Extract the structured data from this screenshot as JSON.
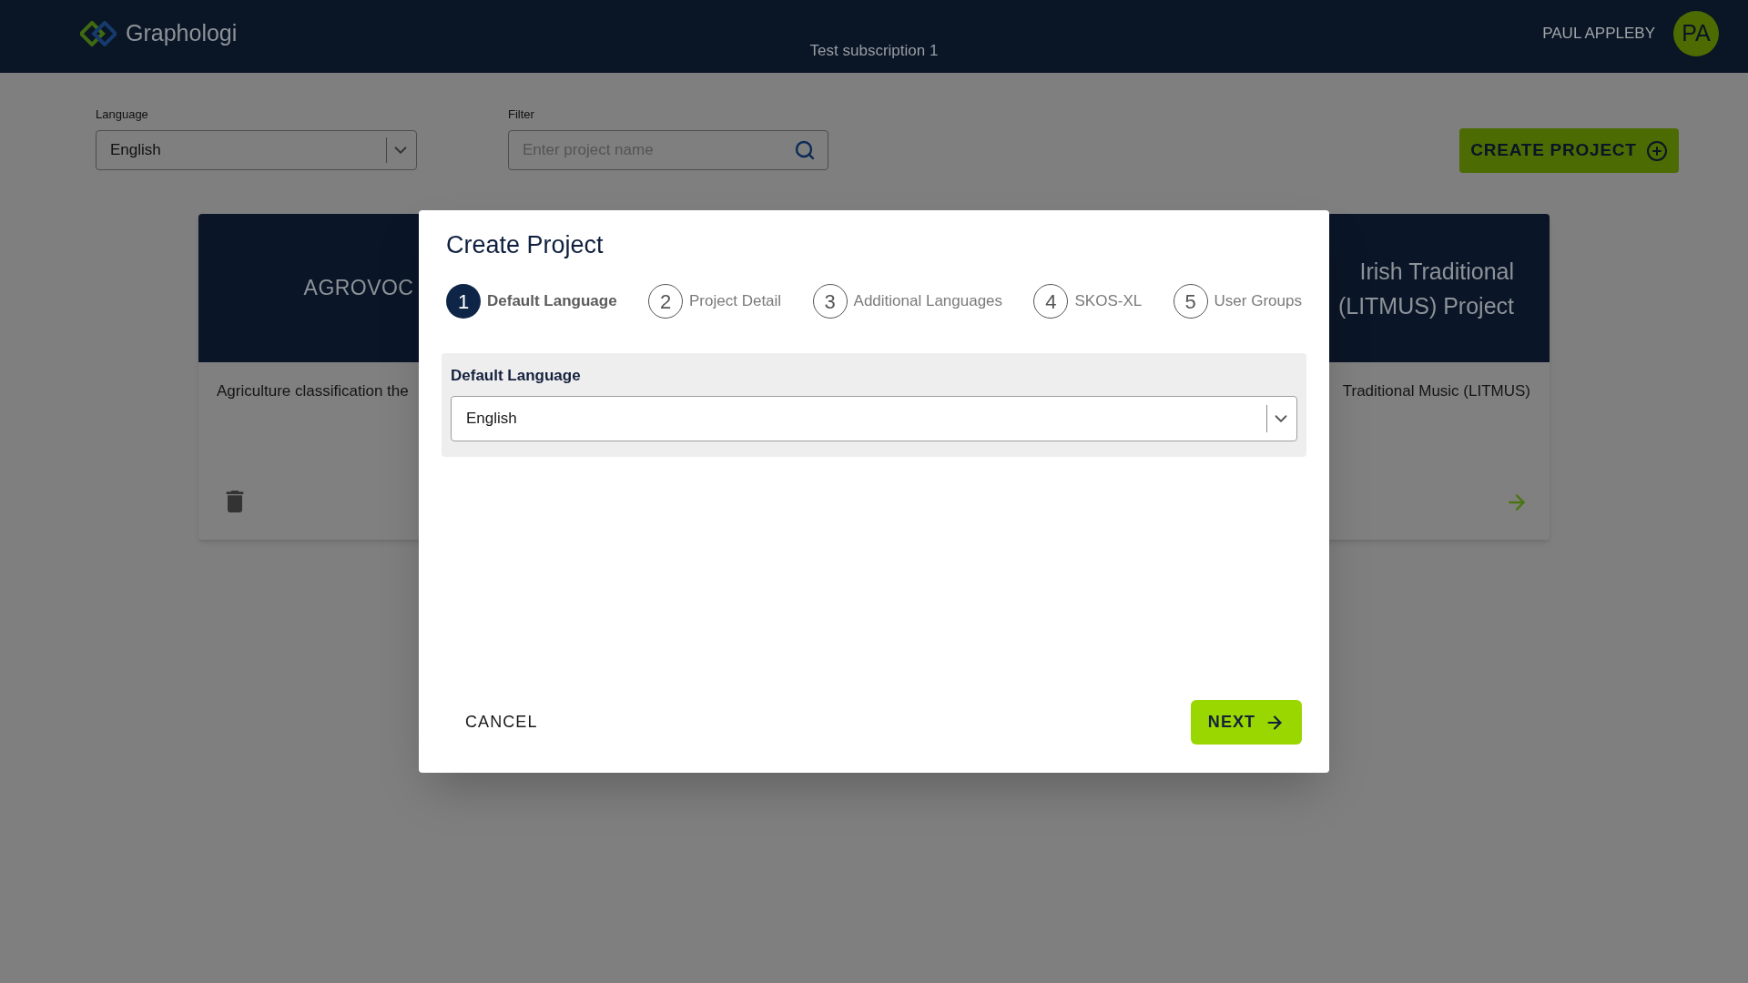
{
  "header": {
    "app_name": "Graphologi",
    "subscription": "Test subscription 1",
    "user_name": "PAUL APPLEBY",
    "avatar_initials": "PA"
  },
  "toolbar": {
    "language": {
      "label": "Language",
      "value": "English"
    },
    "filter": {
      "label": "Filter",
      "placeholder": "Enter project name"
    },
    "create_button": "CREATE PROJECT"
  },
  "project_cards": [
    {
      "title": "AGROVOC",
      "description": "Agriculture classification the",
      "actions": [
        {
          "kind": "delete"
        }
      ]
    },
    {
      "title": "Irish Traditional (LITMUS) Project",
      "description": "Traditional Music (LITMUS)",
      "actions": [
        {
          "kind": "open"
        }
      ]
    }
  ],
  "dialog": {
    "title": "Create Project",
    "steps": [
      {
        "number": "1",
        "label": "Default Language",
        "selected": true
      },
      {
        "number": "2",
        "label": "Project Detail",
        "selected": false
      },
      {
        "number": "3",
        "label": "Additional Languages",
        "selected": false
      },
      {
        "number": "4",
        "label": "SKOS-XL",
        "selected": false
      },
      {
        "number": "5",
        "label": "User Groups",
        "selected": false
      }
    ],
    "section": {
      "label": "Default Language",
      "value": "English"
    },
    "buttons": [
      {
        "label": "CANCEL",
        "kind": "text"
      },
      {
        "label": "NEXT",
        "kind": "primary"
      }
    ]
  }
}
